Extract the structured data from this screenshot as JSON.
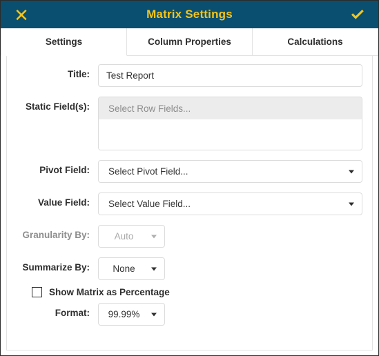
{
  "titlebar": {
    "title": "Matrix Settings",
    "close_icon": "close-x-icon",
    "confirm_icon": "check-icon",
    "background_color": "#0a4f70",
    "icon_color": "#f5c518"
  },
  "tabs": [
    {
      "label": "Settings",
      "active": true
    },
    {
      "label": "Column Properties",
      "active": false
    },
    {
      "label": "Calculations",
      "active": false
    }
  ],
  "form": {
    "title": {
      "label": "Title:",
      "value": "Test Report",
      "placeholder": ""
    },
    "static_fields": {
      "label": "Static Field(s):",
      "placeholder": "Select Row Fields...",
      "selected": []
    },
    "pivot_field": {
      "label": "Pivot Field:",
      "value": "Select Pivot Field...",
      "enabled": true
    },
    "value_field": {
      "label": "Value Field:",
      "value": "Select Value Field...",
      "enabled": true
    },
    "granularity_by": {
      "label": "Granularity By:",
      "value": "Auto",
      "enabled": false
    },
    "summarize_by": {
      "label": "Summarize By:",
      "value": "None",
      "enabled": true
    },
    "show_as_percentage": {
      "label": "Show Matrix as Percentage",
      "checked": false
    },
    "format": {
      "label": "Format:",
      "value": "99.99%",
      "enabled": true
    }
  }
}
